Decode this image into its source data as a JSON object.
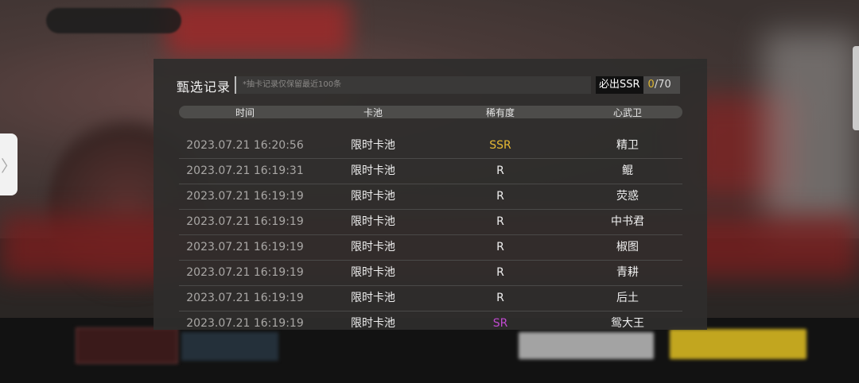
{
  "panel": {
    "title": "甄选记录",
    "notice": "*抽卡记录仅保留最近100条",
    "guarantee_label": "必出SSR",
    "guarantee_current": "0",
    "guarantee_total": "/70"
  },
  "columns": [
    "时间",
    "卡池",
    "稀有度",
    "心武卫"
  ],
  "records": [
    {
      "time": "2023.07.21  16:20:56",
      "pool": "限时卡池",
      "rarity": "SSR",
      "name": "精卫"
    },
    {
      "time": "2023.07.21  16:19:31",
      "pool": "限时卡池",
      "rarity": "R",
      "name": "鲲"
    },
    {
      "time": "2023.07.21  16:19:19",
      "pool": "限时卡池",
      "rarity": "R",
      "name": "荧惑"
    },
    {
      "time": "2023.07.21  16:19:19",
      "pool": "限时卡池",
      "rarity": "R",
      "name": "中书君"
    },
    {
      "time": "2023.07.21  16:19:19",
      "pool": "限时卡池",
      "rarity": "R",
      "name": "椒图"
    },
    {
      "time": "2023.07.21  16:19:19",
      "pool": "限时卡池",
      "rarity": "R",
      "name": "青耕"
    },
    {
      "time": "2023.07.21  16:19:19",
      "pool": "限时卡池",
      "rarity": "R",
      "name": "后土"
    },
    {
      "time": "2023.07.21  16:19:19",
      "pool": "限时卡池",
      "rarity": "SR",
      "name": "鸳大王"
    }
  ],
  "side_tab": {
    "icon": "chevron-right-icon",
    "glyph": "〉"
  },
  "colors": {
    "ssr": "#e6b933",
    "sr": "#c04ad0",
    "accent_count": "#e0b830"
  }
}
